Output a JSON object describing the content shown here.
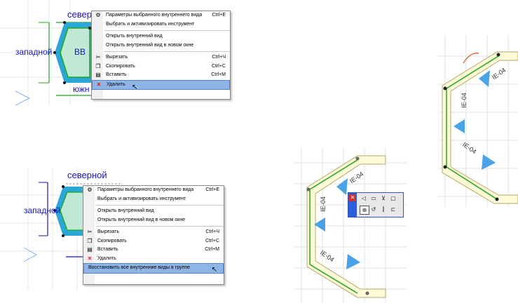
{
  "panel1": {
    "labels": {
      "north": "север",
      "west": "западной",
      "center": "ВВ",
      "south": "южн"
    },
    "menu": {
      "items": [
        {
          "label": "Параметры выбранного внутреннего вида",
          "shortcut": "Ctrl+E",
          "icon": "settings-icon"
        },
        {
          "label": "Выбрать и активизировать инструмент",
          "shortcut": "",
          "icon": ""
        },
        {
          "label": "Открыть внутренний вид",
          "shortcut": "",
          "icon": ""
        },
        {
          "label": "Открыть внутренний вид в новом окне",
          "shortcut": "",
          "icon": ""
        },
        {
          "label": "Вырезать",
          "shortcut": "Ctrl+Ч",
          "icon": "scissors-icon"
        },
        {
          "label": "Скопировать",
          "shortcut": "Ctrl+C",
          "icon": "copy-icon"
        },
        {
          "label": "Вставить",
          "shortcut": "Ctrl+M",
          "icon": "paste-icon"
        },
        {
          "label": "Удалить",
          "shortcut": "",
          "icon": "delete-icon",
          "highlighted": true
        }
      ]
    }
  },
  "panel2": {
    "labels": {
      "north": "северной",
      "west": "западной"
    },
    "menu": {
      "items": [
        {
          "label": "Параметры выбранного внутреннего вида",
          "shortcut": "Ctrl+E",
          "icon": "settings-icon"
        },
        {
          "label": "Выбрать и активизировать инструмент",
          "shortcut": "",
          "icon": ""
        },
        {
          "label": "Открыть внутренний вид",
          "shortcut": "",
          "icon": ""
        },
        {
          "label": "Открыть внутренний вид в новом окне",
          "shortcut": "",
          "icon": ""
        },
        {
          "label": "Вырезать",
          "shortcut": "Ctrl+Ч",
          "icon": "scissors-icon"
        },
        {
          "label": "Скопировать",
          "shortcut": "Ctrl+C",
          "icon": "copy-icon"
        },
        {
          "label": "Вставить",
          "shortcut": "Ctrl+M",
          "icon": "paste-icon"
        },
        {
          "label": "Удалить",
          "shortcut": "",
          "icon": "delete-icon"
        },
        {
          "label": "Восстановить все внутренние виды в группе",
          "shortcut": "",
          "icon": "",
          "highlighted": true
        }
      ]
    }
  },
  "plan_labels": {
    "top_right": [
      "IE-04",
      "IE-04",
      "IE-04"
    ],
    "bottom_mid": [
      "IE-04",
      "IE-04",
      "IE-04"
    ]
  },
  "colors": {
    "highlight": "#8fb4e6",
    "wall_fill": "#fdfbd8",
    "marker_blue": "#4aa3e6",
    "wall_green": "#1ea81e",
    "label_blue": "#1515c8",
    "delete_red": "#e02020"
  }
}
